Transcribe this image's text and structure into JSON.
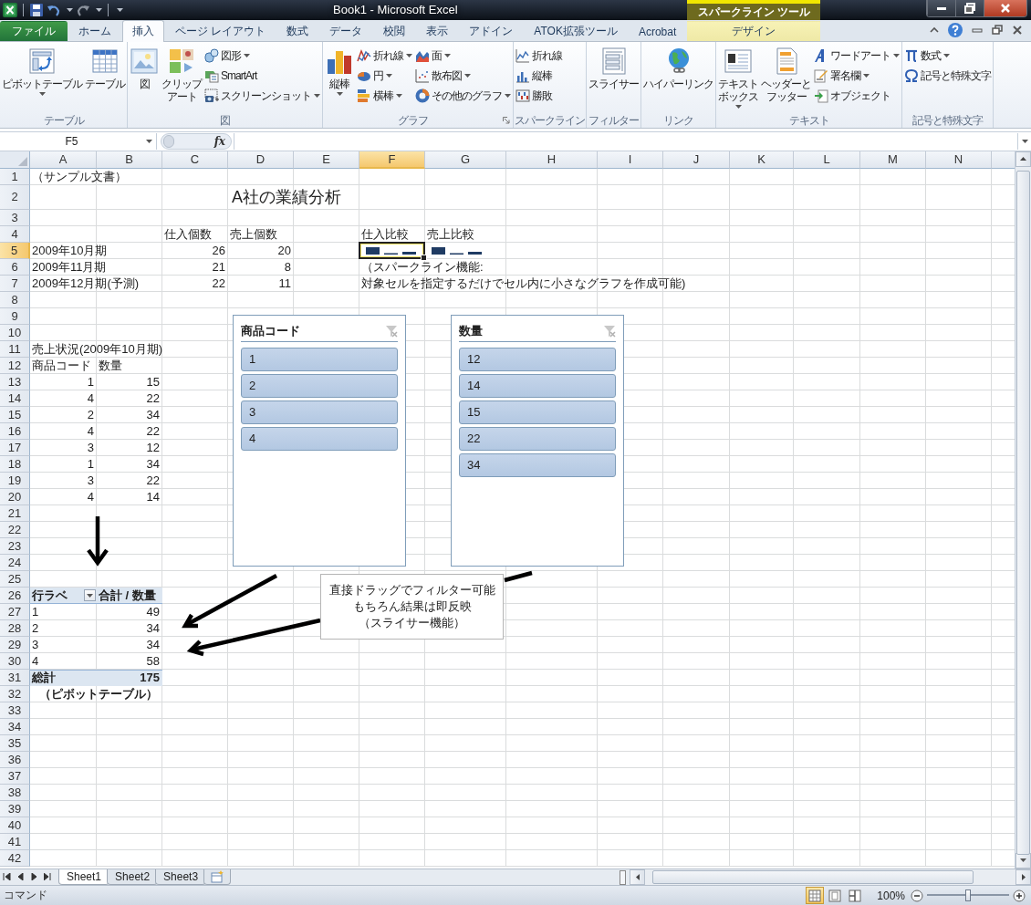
{
  "window": {
    "title": "Book1 - Microsoft Excel",
    "contextual_group": "スパークライン ツール"
  },
  "ribbon_tabs": [
    {
      "label": "ファイル",
      "kind": "file",
      "selected": false
    },
    {
      "label": "ホーム",
      "kind": "normal",
      "selected": false
    },
    {
      "label": "挿入",
      "kind": "normal",
      "selected": true
    },
    {
      "label": "ページ レイアウト",
      "kind": "normal",
      "selected": false
    },
    {
      "label": "数式",
      "kind": "normal",
      "selected": false
    },
    {
      "label": "データ",
      "kind": "normal",
      "selected": false
    },
    {
      "label": "校閲",
      "kind": "normal",
      "selected": false
    },
    {
      "label": "表示",
      "kind": "normal",
      "selected": false
    },
    {
      "label": "アドイン",
      "kind": "normal",
      "selected": false
    },
    {
      "label": "ATOK拡張ツール",
      "kind": "normal",
      "selected": false
    },
    {
      "label": "Acrobat",
      "kind": "normal",
      "selected": false
    },
    {
      "label": "デザイン",
      "kind": "contextual",
      "selected": false
    }
  ],
  "ribbon": {
    "groups": [
      {
        "label": "テーブル",
        "launcher": false,
        "items": [
          {
            "label": "ピボットテーブル",
            "kind": "large",
            "dropdown": true
          },
          {
            "label": "テーブル",
            "kind": "large",
            "dropdown": false
          }
        ]
      },
      {
        "label": "図",
        "launcher": false,
        "items": [
          {
            "label": "図",
            "kind": "large",
            "dropdown": false
          },
          {
            "lines": [
              "クリップ",
              "アート"
            ],
            "kind": "large",
            "dropdown": false
          },
          {
            "label": "図形",
            "kind": "small",
            "dropdown": true
          },
          {
            "label": "SmartArt",
            "kind": "small",
            "dropdown": false
          },
          {
            "label": "スクリーンショット",
            "kind": "small",
            "dropdown": true
          }
        ]
      },
      {
        "label": "グラフ",
        "launcher": true,
        "items": [
          {
            "label": "縦棒",
            "kind": "large",
            "dropdown": true
          },
          {
            "label": "折れ線",
            "kind": "small",
            "dropdown": true
          },
          {
            "label": "円",
            "kind": "small",
            "dropdown": true
          },
          {
            "label": "横棒",
            "kind": "small",
            "dropdown": true
          },
          {
            "label": "面",
            "kind": "small",
            "dropdown": true
          },
          {
            "label": "散布図",
            "kind": "small",
            "dropdown": true
          },
          {
            "label": "その他のグラフ",
            "kind": "small",
            "dropdown": true
          }
        ]
      },
      {
        "label": "スパークライン",
        "launcher": false,
        "items": [
          {
            "label": "折れ線",
            "kind": "small",
            "dropdown": false
          },
          {
            "label": "縦棒",
            "kind": "small",
            "dropdown": false
          },
          {
            "label": "勝敗",
            "kind": "small",
            "dropdown": false
          }
        ]
      },
      {
        "label": "フィルター",
        "launcher": false,
        "items": [
          {
            "label": "スライサー",
            "kind": "large",
            "dropdown": false
          }
        ]
      },
      {
        "label": "リンク",
        "launcher": false,
        "items": [
          {
            "label": "ハイパーリンク",
            "kind": "large",
            "dropdown": false
          }
        ]
      },
      {
        "label": "テキスト",
        "launcher": false,
        "items": [
          {
            "lines": [
              "テキスト",
              "ボックス"
            ],
            "kind": "large",
            "dropdown": true
          },
          {
            "lines": [
              "ヘッダーと",
              "フッター"
            ],
            "kind": "large",
            "dropdown": false
          },
          {
            "label": "ワードアート",
            "kind": "small",
            "dropdown": true
          },
          {
            "label": "署名欄",
            "kind": "small",
            "dropdown": true
          },
          {
            "label": "オブジェクト",
            "kind": "small",
            "dropdown": false
          }
        ]
      },
      {
        "label": "記号と特殊文字",
        "launcher": false,
        "items": [
          {
            "label": "数式",
            "kind": "small",
            "dropdown": true
          },
          {
            "label": "記号と特殊文字",
            "kind": "small",
            "dropdown": false
          }
        ]
      }
    ]
  },
  "formula_bar": {
    "name_box": "F5",
    "function_button": "fx"
  },
  "sheet": {
    "columns": [
      {
        "label": "A",
        "selected": false
      },
      {
        "label": "B",
        "selected": false
      },
      {
        "label": "C",
        "selected": false
      },
      {
        "label": "D",
        "selected": false
      },
      {
        "label": "E",
        "selected": false
      },
      {
        "label": "F",
        "selected": true
      },
      {
        "label": "G",
        "selected": false
      },
      {
        "label": "H",
        "selected": false
      },
      {
        "label": "I",
        "selected": false
      },
      {
        "label": "J",
        "selected": false
      },
      {
        "label": "K",
        "selected": false
      },
      {
        "label": "L",
        "selected": false
      },
      {
        "label": "M",
        "selected": false
      },
      {
        "label": "N",
        "selected": false
      }
    ],
    "rows": [
      {
        "label": "1",
        "selected": false,
        "cells": [
          {
            "kind": "text",
            "text": "（サンプル文書）"
          }
        ]
      },
      {
        "label": "2",
        "selected": false,
        "cells": [
          {
            "kind": "empty"
          },
          {
            "kind": "empty"
          },
          {
            "kind": "empty"
          },
          {
            "kind": "title",
            "text": "A社の業績分析"
          }
        ]
      },
      {
        "label": "3",
        "selected": false
      },
      {
        "label": "4",
        "selected": false,
        "cells": [
          {
            "kind": "empty"
          },
          {
            "kind": "empty"
          },
          {
            "kind": "text",
            "text": "仕入個数"
          },
          {
            "kind": "text",
            "text": "売上個数"
          },
          {
            "kind": "empty"
          },
          {
            "kind": "text",
            "text": "仕入比較"
          },
          {
            "kind": "text",
            "text": "売上比較"
          }
        ]
      },
      {
        "label": "5",
        "selected": true,
        "cells": [
          {
            "kind": "text",
            "text": "2009年10月期"
          },
          {
            "kind": "empty"
          },
          {
            "kind": "number",
            "text": "26"
          },
          {
            "kind": "number",
            "text": "20"
          },
          {
            "kind": "empty"
          },
          {
            "kind": "sparkline"
          },
          {
            "kind": "sparkline"
          }
        ]
      },
      {
        "label": "6",
        "selected": false,
        "cells": [
          {
            "kind": "text",
            "text": "2009年11月期"
          },
          {
            "kind": "empty"
          },
          {
            "kind": "number",
            "text": "21"
          },
          {
            "kind": "number",
            "text": "8"
          },
          {
            "kind": "empty"
          },
          {
            "kind": "text",
            "text": "（スパークライン機能:"
          }
        ]
      },
      {
        "label": "7",
        "selected": false,
        "cells": [
          {
            "kind": "text",
            "text": "2009年12月期(予測)"
          },
          {
            "kind": "empty"
          },
          {
            "kind": "number",
            "text": "22"
          },
          {
            "kind": "number",
            "text": "11"
          },
          {
            "kind": "empty"
          },
          {
            "kind": "text",
            "text": "対象セルを指定するだけでセル内に小さなグラフを作成可能)"
          }
        ]
      },
      {
        "label": "8",
        "selected": false
      },
      {
        "label": "9",
        "selected": false
      },
      {
        "label": "10",
        "selected": false
      },
      {
        "label": "11",
        "selected": false,
        "cells": [
          {
            "kind": "text",
            "text": "売上状況(2009年10月期)"
          }
        ]
      },
      {
        "label": "12",
        "selected": false,
        "cells": [
          {
            "kind": "text",
            "text": "商品コード"
          },
          {
            "kind": "text",
            "text": "数量"
          }
        ]
      },
      {
        "label": "13",
        "selected": false,
        "cells": [
          {
            "kind": "number",
            "text": "1"
          },
          {
            "kind": "number",
            "text": "15"
          }
        ]
      },
      {
        "label": "14",
        "selected": false,
        "cells": [
          {
            "kind": "number",
            "text": "4"
          },
          {
            "kind": "number",
            "text": "22"
          }
        ]
      },
      {
        "label": "15",
        "selected": false,
        "cells": [
          {
            "kind": "number",
            "text": "2"
          },
          {
            "kind": "number",
            "text": "34"
          }
        ]
      },
      {
        "label": "16",
        "selected": false,
        "cells": [
          {
            "kind": "number",
            "text": "4"
          },
          {
            "kind": "number",
            "text": "22"
          }
        ]
      },
      {
        "label": "17",
        "selected": false,
        "cells": [
          {
            "kind": "number",
            "text": "3"
          },
          {
            "kind": "number",
            "text": "12"
          }
        ]
      },
      {
        "label": "18",
        "selected": false,
        "cells": [
          {
            "kind": "number",
            "text": "1"
          },
          {
            "kind": "number",
            "text": "34"
          }
        ]
      },
      {
        "label": "19",
        "selected": false,
        "cells": [
          {
            "kind": "number",
            "text": "3"
          },
          {
            "kind": "number",
            "text": "22"
          }
        ]
      },
      {
        "label": "20",
        "selected": false,
        "cells": [
          {
            "kind": "number",
            "text": "4"
          },
          {
            "kind": "number",
            "text": "14"
          }
        ]
      },
      {
        "label": "21",
        "selected": false
      },
      {
        "label": "22",
        "selected": false
      },
      {
        "label": "23",
        "selected": false
      },
      {
        "label": "24",
        "selected": false
      },
      {
        "label": "25",
        "selected": false
      },
      {
        "label": "26",
        "selected": false,
        "cells": [
          {
            "kind": "pivot-header",
            "text": "行ラベ",
            "filter": true
          },
          {
            "kind": "pivot-header",
            "text": "合計 / 数量",
            "filter": false
          }
        ]
      },
      {
        "label": "27",
        "selected": false,
        "cells": [
          {
            "kind": "text",
            "text": "1"
          },
          {
            "kind": "number",
            "text": "49"
          }
        ]
      },
      {
        "label": "28",
        "selected": false,
        "cells": [
          {
            "kind": "text",
            "text": "2"
          },
          {
            "kind": "number",
            "text": "34"
          }
        ]
      },
      {
        "label": "29",
        "selected": false,
        "cells": [
          {
            "kind": "text",
            "text": "3"
          },
          {
            "kind": "number",
            "text": "34"
          }
        ]
      },
      {
        "label": "30",
        "selected": false,
        "cells": [
          {
            "kind": "text",
            "text": "4"
          },
          {
            "kind": "number",
            "text": "58"
          }
        ]
      },
      {
        "label": "31",
        "selected": false,
        "cells": [
          {
            "kind": "pivot-total",
            "text": "総計"
          },
          {
            "kind": "pivot-total-number",
            "text": "175"
          }
        ]
      },
      {
        "label": "32",
        "selected": false,
        "cells": [
          {
            "kind": "note",
            "text": "（ピボットテーブル）"
          }
        ]
      },
      {
        "label": "33",
        "selected": false
      },
      {
        "label": "34",
        "selected": false
      },
      {
        "label": "35",
        "selected": false
      },
      {
        "label": "36",
        "selected": false
      },
      {
        "label": "37",
        "selected": false
      },
      {
        "label": "38",
        "selected": false
      },
      {
        "label": "39",
        "selected": false
      },
      {
        "label": "40",
        "selected": false
      },
      {
        "label": "41",
        "selected": false
      },
      {
        "label": "42",
        "selected": false
      }
    ]
  },
  "slicers": [
    {
      "title": "商品コード",
      "items": [
        {
          "label": "1",
          "selected": true
        },
        {
          "label": "2",
          "selected": true
        },
        {
          "label": "3",
          "selected": true
        },
        {
          "label": "4",
          "selected": true
        }
      ]
    },
    {
      "title": "数量",
      "items": [
        {
          "label": "12",
          "selected": true
        },
        {
          "label": "14",
          "selected": true
        },
        {
          "label": "15",
          "selected": true
        },
        {
          "label": "22",
          "selected": true
        },
        {
          "label": "34",
          "selected": true
        }
      ]
    }
  ],
  "callout": {
    "lines": [
      "直接ドラッグでフィルター可能",
      "もちろん結果は即反映",
      "（スライサー機能）"
    ]
  },
  "sheet_tabs": [
    {
      "label": "Sheet1",
      "selected": true
    },
    {
      "label": "Sheet2",
      "selected": false
    },
    {
      "label": "Sheet3",
      "selected": false
    }
  ],
  "status_bar": {
    "mode": "コマンド",
    "views": [
      {
        "selected": true
      },
      {
        "selected": false
      },
      {
        "selected": false
      }
    ],
    "zoom": "100%",
    "level": 0.5
  }
}
